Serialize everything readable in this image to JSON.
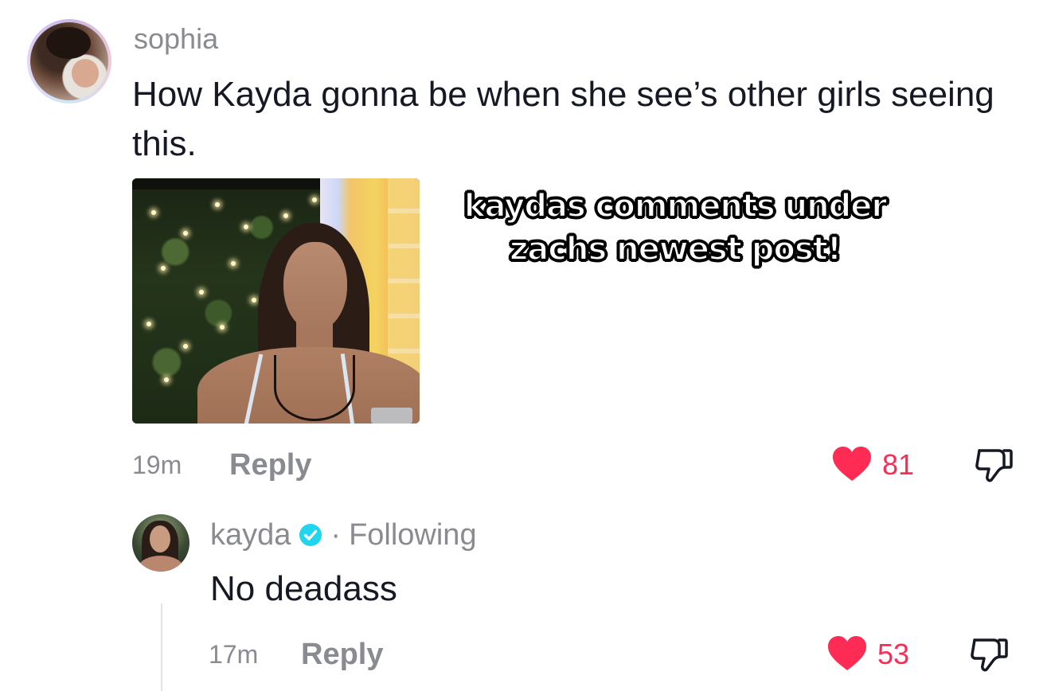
{
  "comment": {
    "username": "sophia",
    "text": "How Kayda gonna be when she see’s other girls seeing this.",
    "overlay_caption_line1": "kaydas comments under",
    "overlay_caption_line2": "zachs newest post!",
    "time": "19m",
    "reply_label": "Reply",
    "like_count": "81"
  },
  "reply": {
    "username": "kayda",
    "separator": "·",
    "following_label": "Following",
    "text": "No deadass",
    "time": "17m",
    "reply_label": "Reply",
    "like_count": "53"
  },
  "colors": {
    "like": "#fe2c55",
    "muted": "#8a8b91",
    "verified": "#20d5ec"
  },
  "icons": {
    "heart": "heart-icon",
    "dislike": "thumbs-down-icon",
    "verified": "verified-badge-icon"
  }
}
